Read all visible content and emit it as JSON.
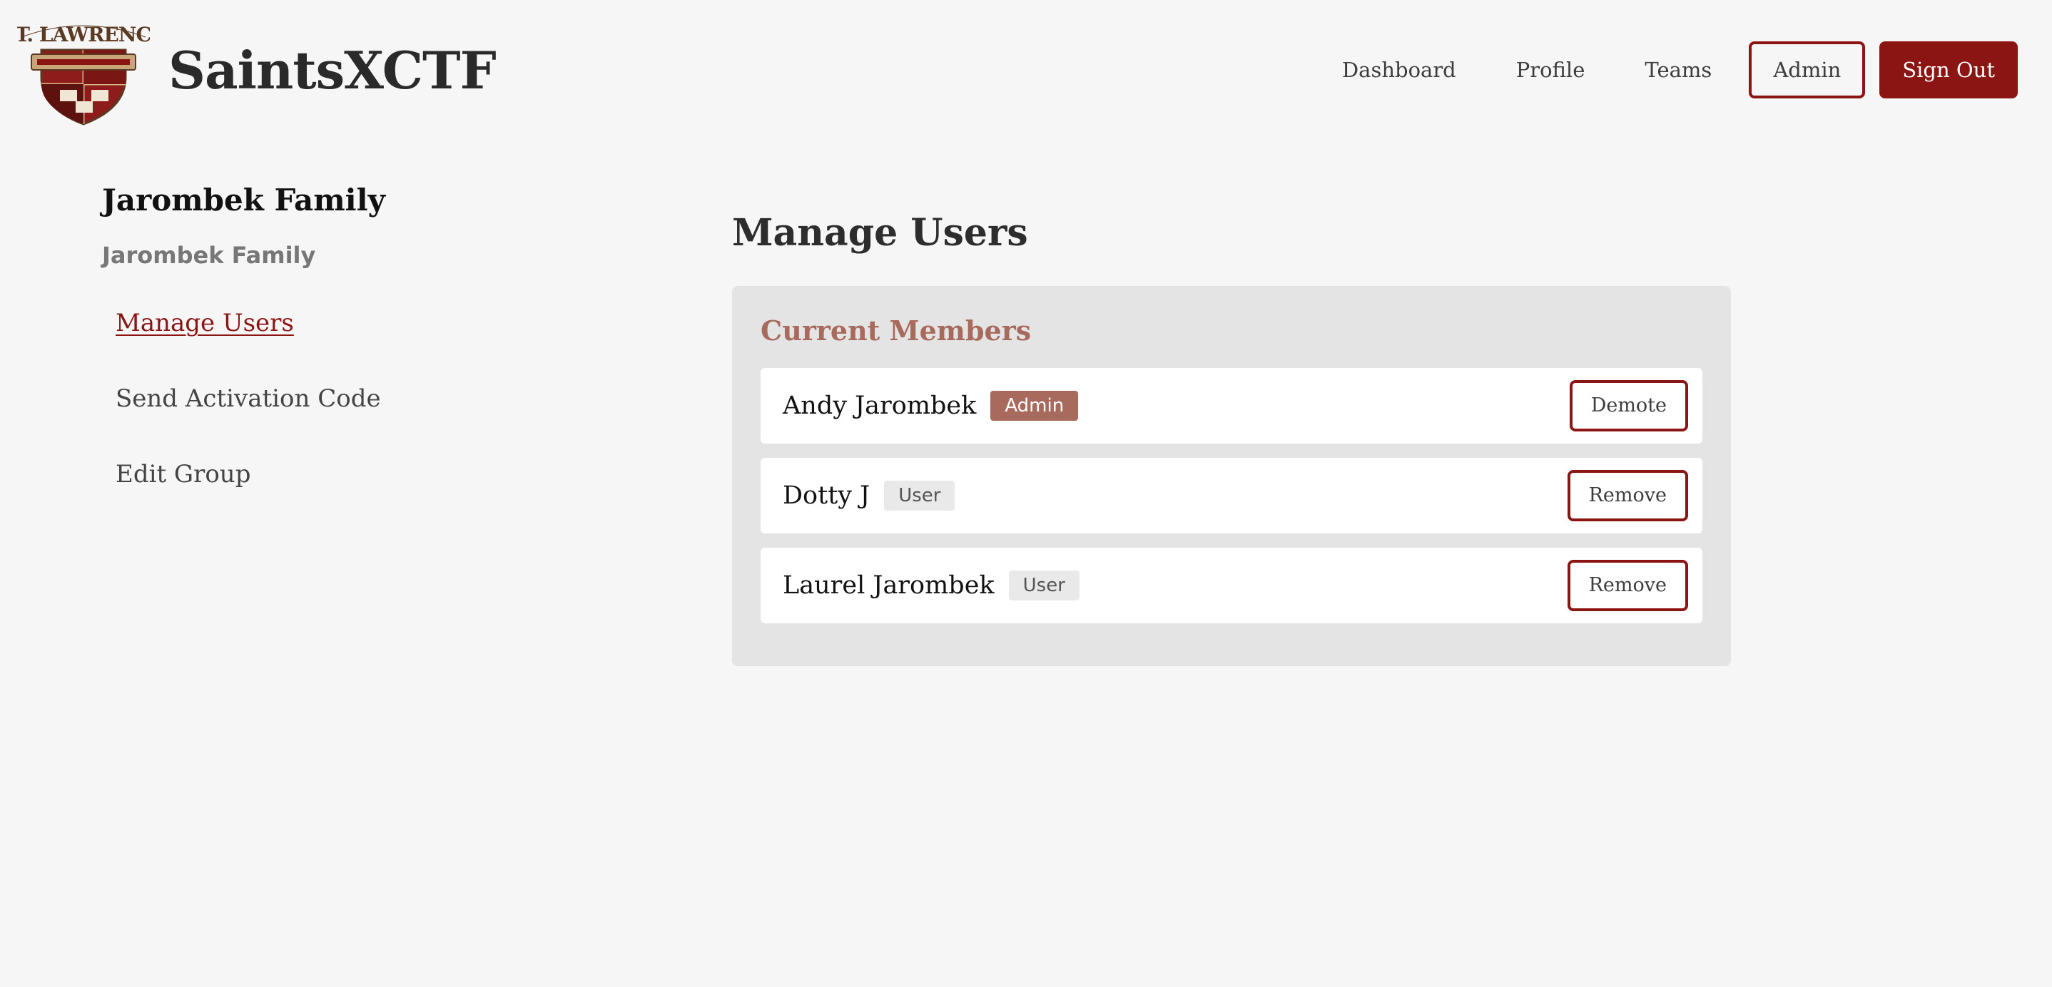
{
  "header": {
    "logo_alt": "St. Lawrence Cross Country Track & Field crest",
    "logo_text": "ST. LAWRENCE",
    "site_title": "SaintsXCTF",
    "nav": {
      "dashboard": "Dashboard",
      "profile": "Profile",
      "teams": "Teams",
      "admin": "Admin",
      "sign_out": "Sign Out"
    }
  },
  "sidebar": {
    "group_title": "Jarombek Family",
    "group_subtitle": "Jarombek Family",
    "items": [
      {
        "label": "Manage Users",
        "active": true
      },
      {
        "label": "Send Activation Code",
        "active": false
      },
      {
        "label": "Edit Group",
        "active": false
      }
    ]
  },
  "main": {
    "title": "Manage Users",
    "panel_title": "Current Members",
    "members": [
      {
        "name": "Andy Jarombek",
        "role": "Admin",
        "action": "Demote"
      },
      {
        "name": "Dotty J",
        "role": "User",
        "action": "Remove"
      },
      {
        "name": "Laurel Jarombek",
        "role": "User",
        "action": "Remove"
      }
    ]
  },
  "colors": {
    "brand": "#8a1512",
    "accent": "#a86a5c",
    "background": "#f6f6f6",
    "panel": "#e4e4e4"
  }
}
